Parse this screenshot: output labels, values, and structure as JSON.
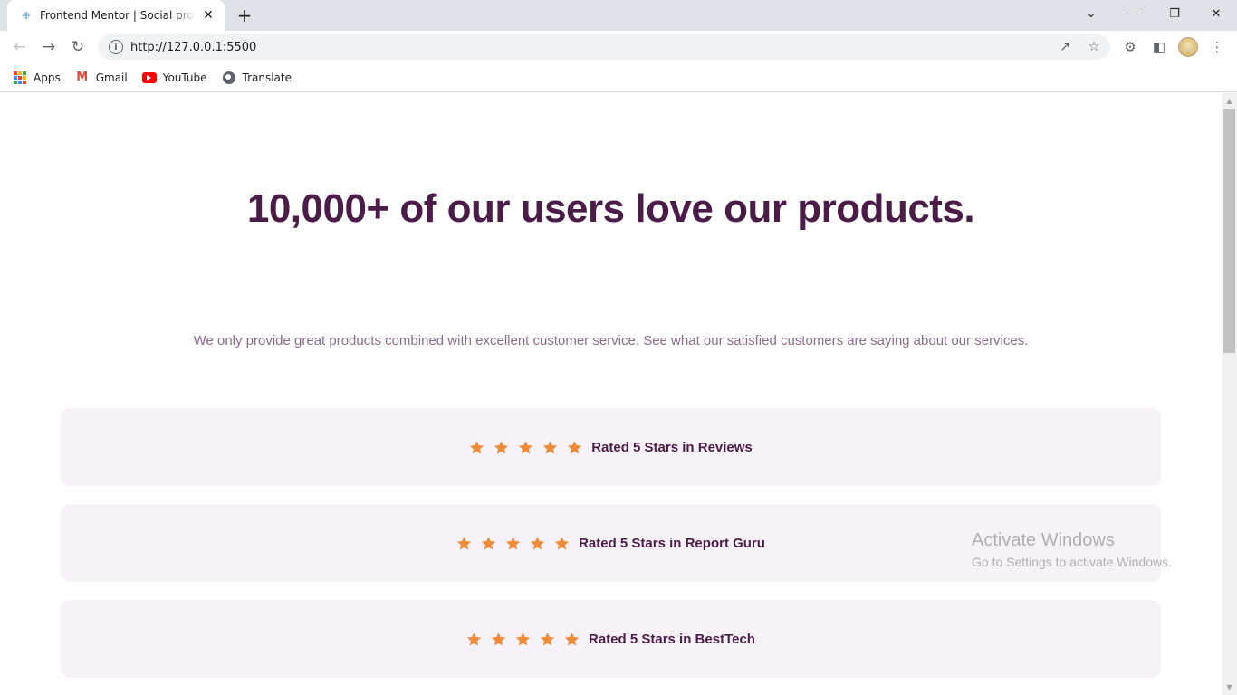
{
  "browser": {
    "tab": {
      "title": "Frontend Mentor | Social proof se",
      "favicon": "fm-logo-icon"
    },
    "url": "http://127.0.0.1:5500",
    "bookmarks": [
      {
        "label": "Apps",
        "icon": "apps-grid-icon"
      },
      {
        "label": "Gmail",
        "icon": "gmail-icon"
      },
      {
        "label": "YouTube",
        "icon": "youtube-icon"
      },
      {
        "label": "Translate",
        "icon": "globe-icon"
      }
    ]
  },
  "page": {
    "headline": "10,000+ of our users love our products.",
    "intro": "We only provide great products combined with excellent customer service. See what our satisfied customers are saying about our services.",
    "ratings": [
      {
        "label": "Rated 5 Stars in Reviews",
        "stars": 5
      },
      {
        "label": "Rated 5 Stars in Report Guru",
        "stars": 5
      },
      {
        "label": "Rated 5 Stars in BestTech",
        "stars": 5
      }
    ],
    "colors": {
      "heading": "#4b1c47",
      "text_muted": "#8b6d8a",
      "card_bg": "#f7f2f7",
      "star": "#ee8c3a"
    }
  },
  "watermark": {
    "title": "Activate Windows",
    "subtitle": "Go to Settings to activate Windows."
  }
}
